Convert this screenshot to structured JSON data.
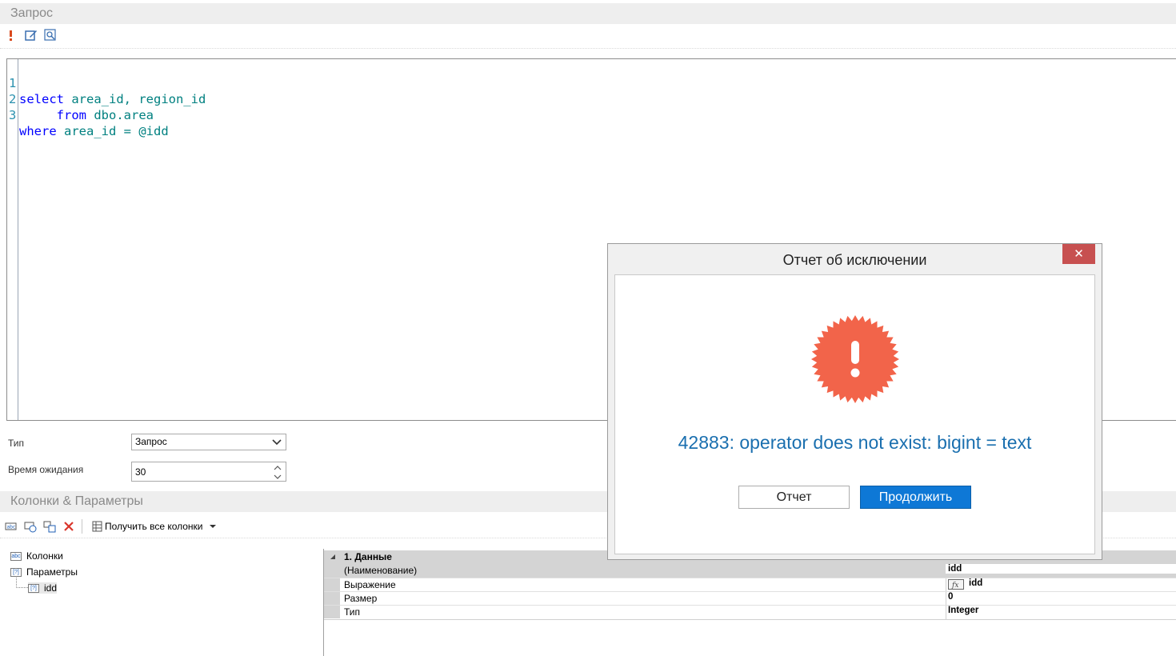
{
  "query_section": {
    "title": "Запрос",
    "toolbar": {
      "icons": [
        "exclamation-icon",
        "edit-icon",
        "preview-icon"
      ]
    },
    "editor": {
      "lines": [
        {
          "number": "1",
          "tokens": [
            {
              "t": "select",
              "c": "kw"
            },
            {
              "t": " area_id, region_id",
              "c": "id"
            }
          ]
        },
        {
          "number": "2",
          "tokens": [
            {
              "t": "     from",
              "c": "kw"
            },
            {
              "t": " dbo.area",
              "c": "id"
            }
          ]
        },
        {
          "number": "3",
          "tokens": [
            {
              "t": "where",
              "c": "kw"
            },
            {
              "t": " area_id = @idd",
              "c": "id"
            }
          ]
        }
      ]
    },
    "type_label": "Тип",
    "type_value": "Запрос",
    "timeout_label": "Время ожидания",
    "timeout_value": "30"
  },
  "columns_section": {
    "title": "Колонки & Параметры",
    "get_all_columns_label": "Получить все колонки",
    "tree": {
      "columns": "Колонки",
      "parameters": "Параметры",
      "param_idd": "idd"
    },
    "property_grid": {
      "category": "1. Данные",
      "rows": [
        {
          "name": "(Наименование)",
          "value": "idd"
        },
        {
          "name": "Выражение",
          "value": "idd"
        },
        {
          "name": "Размер",
          "value": "0"
        },
        {
          "name": "Тип",
          "value": "Integer"
        }
      ]
    }
  },
  "dialog": {
    "title": "Отчет об исключении",
    "close_symbol": "✕",
    "message": "42883: operator does not exist: bigint = text",
    "report_button": "Отчет",
    "continue_button": "Продолжить",
    "icon": "error-badge-icon"
  },
  "colors": {
    "keyword": "#0000ff",
    "identifier": "#008080",
    "line_number": "#2b91af",
    "error_badge": "#f2644a",
    "message": "#1a6faf",
    "accent_button": "#0e78d6",
    "close_button": "#c75050"
  }
}
